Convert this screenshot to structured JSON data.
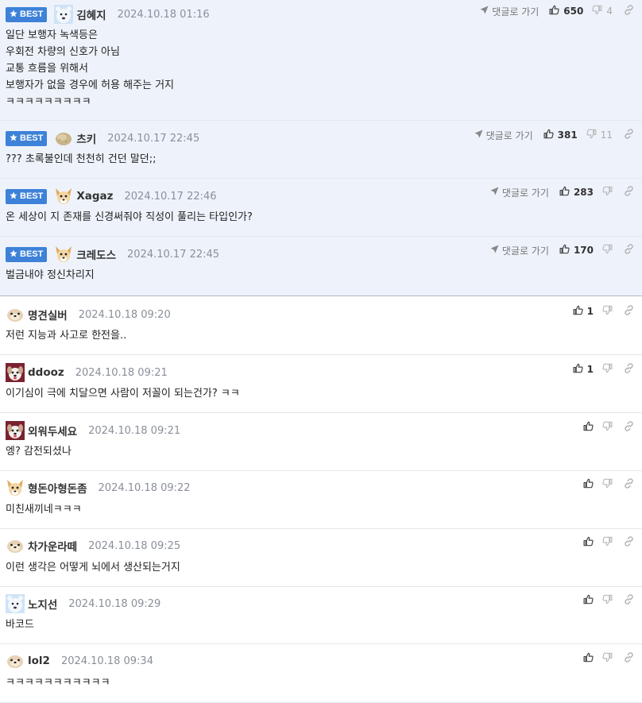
{
  "labels": {
    "best": "BEST",
    "reply": "댓글로 가기"
  },
  "colors": {
    "best_bg": "#eef3fb",
    "badge": "#3d82d8"
  },
  "comments": [
    {
      "best": true,
      "avatar": "polar-bear-avatar",
      "name": "김혜지",
      "date": "2024.10.18 01:16",
      "text": "일단 보행자 녹색등은\n우회전 차량의 신호가 아님\n교통 흐름을 위해서\n보행자가 없을 경우에 허용 해주는 거지\nㅋㅋㅋㅋㅋㅋㅋㅋㅋ",
      "likes": "650",
      "dislikes": "4"
    },
    {
      "best": true,
      "avatar": "potato-avatar",
      "name": "츠키",
      "date": "2024.10.17 22:45",
      "text": "??? 초록불인데 천천히 건던 말던;;",
      "likes": "381",
      "dislikes": "11"
    },
    {
      "best": true,
      "avatar": "chihuahua-avatar",
      "name": "Xagaz",
      "date": "2024.10.17 22:46",
      "text": "온 세상이 지 존재를 신경써줘야 직성이 풀리는 타입인가?",
      "likes": "283",
      "dislikes": ""
    },
    {
      "best": true,
      "avatar": "chihuahua-avatar",
      "name": "크레도스",
      "date": "2024.10.17 22:45",
      "text": "벌금내야 정신차리지",
      "likes": "170",
      "dislikes": ""
    },
    {
      "best": false,
      "avatar": "seal-avatar",
      "name": "명견실버",
      "date": "2024.10.18 09:20",
      "text": "저런 지능과 사고로 한전을..",
      "likes": "1",
      "dislikes": ""
    },
    {
      "best": false,
      "avatar": "dog-avatar",
      "name": "ddooz",
      "date": "2024.10.18 09:21",
      "text": "이기심이 극에 치달으면 사람이 저꼴이 되는건가? ㅋㅋ",
      "likes": "1",
      "dislikes": ""
    },
    {
      "best": false,
      "avatar": "dog-avatar",
      "name": "외워두세요",
      "date": "2024.10.18 09:21",
      "text": "엥? 감전되셨나",
      "likes": "",
      "dislikes": ""
    },
    {
      "best": false,
      "avatar": "chihuahua-avatar",
      "name": "형돈아형돈좀",
      "date": "2024.10.18 09:22",
      "text": "미친새끼네ㅋㅋㅋ",
      "likes": "",
      "dislikes": ""
    },
    {
      "best": false,
      "avatar": "seal-avatar",
      "name": "차가운라떼",
      "date": "2024.10.18 09:25",
      "text": "이런 생각은 어떻게 뇌에서 생산되는거지",
      "likes": "",
      "dislikes": ""
    },
    {
      "best": false,
      "avatar": "polar-bear-avatar",
      "name": "노지선",
      "date": "2024.10.18 09:29",
      "text": "바코드",
      "likes": "",
      "dislikes": ""
    },
    {
      "best": false,
      "avatar": "seal-avatar",
      "name": "lol2",
      "date": "2024.10.18 09:34",
      "text": "ㅋㅋㅋㅋㅋㅋㅋㅋㅋㅋㅋ",
      "likes": "",
      "dislikes": ""
    }
  ]
}
